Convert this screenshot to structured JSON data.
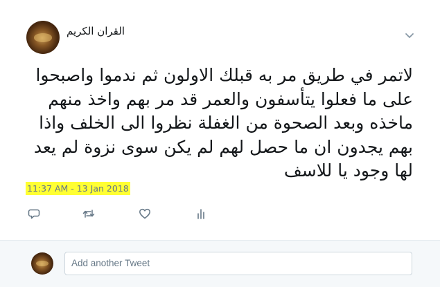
{
  "tweet": {
    "author_name": "القران الكريم",
    "text": "لاتمر في طريق مر به قبلك الاولون ثم ندموا واصبحوا على ما فعلوا يتأسفون والعمر قد مر بهم واخذ منهم ماخذه وبعد الصحوة من الغفلة نظروا الى الخلف واذا بهم يجدون ان ما حصل لهم لم يكن سوى نزوة لم يعد لها وجود يا للاسف",
    "timestamp": "11:37 AM - 13 Jan 2018",
    "highlight_color": "#ffff33"
  },
  "actions": [
    {
      "icon": "reply-icon"
    },
    {
      "icon": "retweet-icon"
    },
    {
      "icon": "like-icon"
    },
    {
      "icon": "analytics-icon"
    }
  ],
  "compose": {
    "placeholder": "Add another Tweet"
  },
  "colors": {
    "text": "#14171a",
    "secondary": "#657786",
    "compose_background": "#f5f8fa",
    "border": "#ccd6dd"
  }
}
